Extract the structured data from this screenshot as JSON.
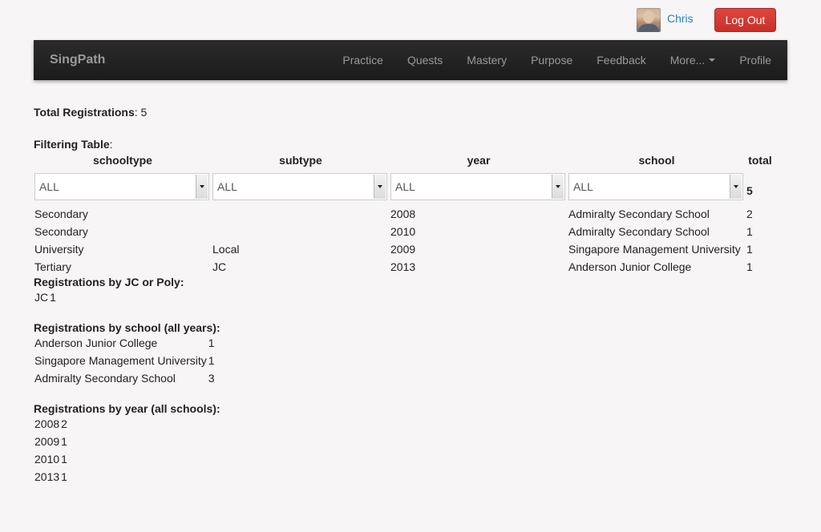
{
  "user": {
    "name": "Chris",
    "logout_label": "Log Out"
  },
  "navbar": {
    "brand": "SingPath",
    "items": [
      "Practice",
      "Quests",
      "Mastery",
      "Purpose",
      "Feedback",
      "More...",
      "Profile"
    ]
  },
  "summary": {
    "total_label": "Total Registrations",
    "total_value": ": 5"
  },
  "filtering": {
    "title": "Filtering Table",
    "title_suffix": ":",
    "columns": [
      "schooltype",
      "subtype",
      "year",
      "school",
      "total"
    ],
    "filters": [
      "ALL",
      "ALL",
      "ALL",
      "ALL"
    ],
    "filter_total": "5",
    "rows": [
      [
        "Secondary",
        "",
        "2008",
        "Admiralty Secondary School",
        "2"
      ],
      [
        "Secondary",
        "",
        "2010",
        "Admiralty Secondary School",
        "1"
      ],
      [
        "University",
        "Local",
        "2009",
        "Singapore Management University",
        "1"
      ],
      [
        "Tertiary",
        "JC",
        "2013",
        "Anderson Junior College",
        "1"
      ]
    ]
  },
  "by_jc_poly": {
    "title": "Registrations by JC or Poly",
    "rows": [
      [
        "JC",
        "1"
      ]
    ]
  },
  "by_school": {
    "title": "Registrations by school (all years)",
    "rows": [
      [
        "Anderson Junior College",
        "1"
      ],
      [
        "Singapore Management University",
        "1"
      ],
      [
        "Admiralty Secondary School",
        "3"
      ]
    ]
  },
  "by_year": {
    "title": "Registrations by year (all schools)",
    "rows": [
      [
        "2008",
        "2"
      ],
      [
        "2009",
        "1"
      ],
      [
        "2010",
        "1"
      ],
      [
        "2013",
        "1"
      ]
    ]
  }
}
